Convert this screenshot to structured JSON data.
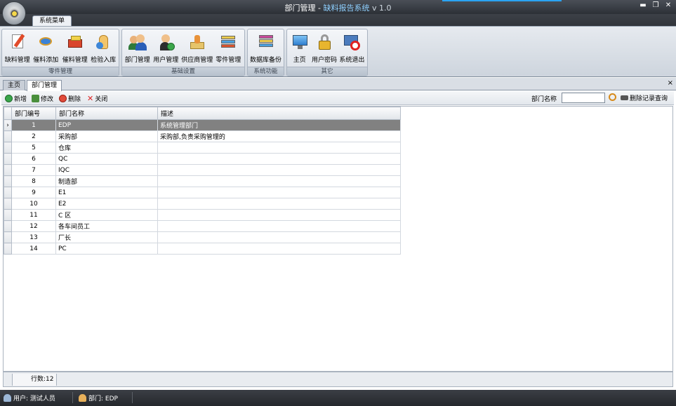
{
  "window": {
    "title_prefix": "部门管理 - ",
    "app_name": "缺料报告系统",
    "version": "v 1.0",
    "min_label": "▬",
    "restore_label": "❐",
    "close_label": "✕"
  },
  "ribbon": {
    "tab_label": "系统菜单",
    "groups": [
      {
        "label": "零件管理",
        "buttons": [
          "缺料管理",
          "催料添加",
          "催料管理",
          "检验入库"
        ]
      },
      {
        "label": "基础设置",
        "buttons": [
          "部门管理",
          "用户管理",
          "供应商管理",
          "零件管理"
        ]
      },
      {
        "label": "系统功能",
        "buttons": [
          "数据库备份"
        ]
      },
      {
        "label": "其它",
        "buttons": [
          "主页",
          "用户密码",
          "系统退出"
        ]
      }
    ]
  },
  "doc_tabs": {
    "tabs": [
      "主页",
      "部门管理"
    ],
    "active": "部门管理",
    "close_label": "×"
  },
  "toolbar": {
    "add_label": "新增",
    "edit_label": "修改",
    "delete_label": "删除",
    "close_label": "关闭",
    "search_label": "部门名称",
    "search_value": "",
    "clear_query_label": "删除记录查询"
  },
  "grid": {
    "columns": [
      "部门编号",
      "部门名称",
      "描述"
    ],
    "rows": [
      {
        "id": "1",
        "name": "EDP",
        "desc": "系统管理部门"
      },
      {
        "id": "2",
        "name": "采购部",
        "desc": "采购部,负责采购管理的"
      },
      {
        "id": "5",
        "name": "仓库",
        "desc": ""
      },
      {
        "id": "6",
        "name": "QC",
        "desc": ""
      },
      {
        "id": "7",
        "name": "IQC",
        "desc": ""
      },
      {
        "id": "8",
        "name": "制造部",
        "desc": ""
      },
      {
        "id": "9",
        "name": "E1",
        "desc": ""
      },
      {
        "id": "10",
        "name": "E2",
        "desc": ""
      },
      {
        "id": "11",
        "name": "C 区",
        "desc": ""
      },
      {
        "id": "12",
        "name": "各车间员工",
        "desc": ""
      },
      {
        "id": "13",
        "name": "厂长",
        "desc": ""
      },
      {
        "id": "14",
        "name": "PC",
        "desc": ""
      }
    ],
    "selected_row_indicator": "›",
    "row_count_label": "行数:12"
  },
  "status": {
    "user": "用户: 测试人员",
    "dept": "部门: EDP"
  },
  "colors": {
    "accent": "#2aa3f3",
    "selected_row": "#818181"
  }
}
